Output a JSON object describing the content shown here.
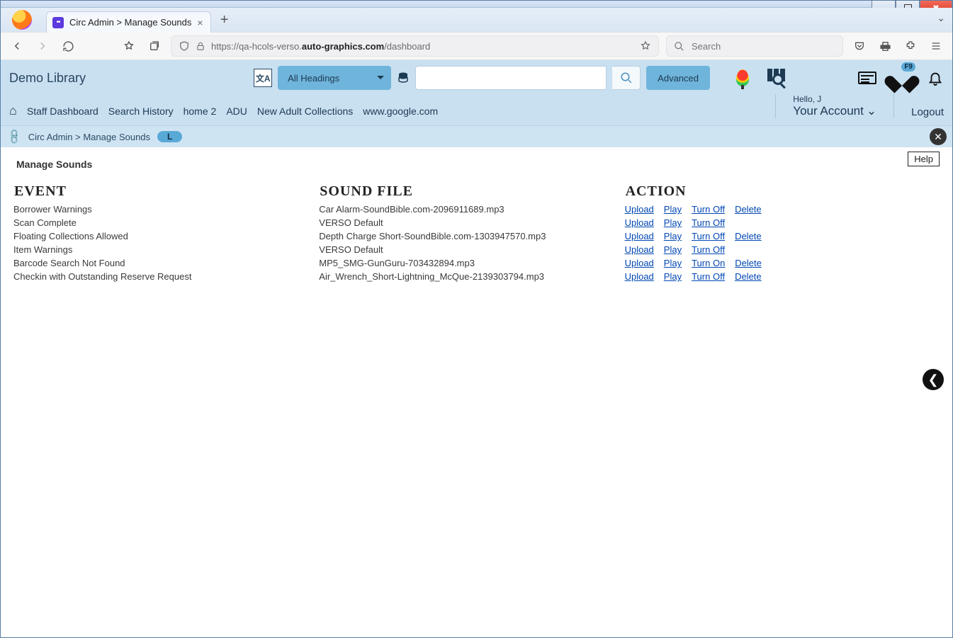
{
  "browser": {
    "tab_title": "Circ Admin > Manage Sounds",
    "url_prefix": "https://qa-hcols-verso.",
    "url_bold": "auto-graphics.com",
    "url_suffix": "/dashboard",
    "search_placeholder": "Search"
  },
  "app": {
    "brand": "Demo Library",
    "heading_select": "All Headings",
    "advanced": "Advanced",
    "nav": [
      "Staff Dashboard",
      "Search History",
      "home 2",
      "ADU",
      "New Adult Collections",
      "www.google.com"
    ],
    "hello": "Hello, J",
    "your_account": "Your Account",
    "logout": "Logout",
    "fav_badge": "F9"
  },
  "crumb": {
    "path": "Circ Admin > Manage Sounds",
    "pill": "L"
  },
  "page": {
    "title": "Manage Sounds",
    "help": "Help",
    "headers": {
      "event": "EVENT",
      "sound": "SOUND FILE",
      "action": "ACTION"
    },
    "action_labels": {
      "upload": "Upload",
      "play": "Play",
      "turn_on": "Turn On",
      "turn_off": "Turn Off",
      "delete": "Delete"
    },
    "rows": [
      {
        "event": "Borrower Warnings",
        "sound": "Car Alarm-SoundBible.com-2096911689.mp3",
        "toggle": "off",
        "delete": true
      },
      {
        "event": "Scan Complete",
        "sound": "VERSO Default",
        "toggle": "off",
        "delete": false
      },
      {
        "event": "Floating Collections Allowed",
        "sound": "Depth Charge Short-SoundBible.com-1303947570.mp3",
        "toggle": "off",
        "delete": true
      },
      {
        "event": "Item Warnings",
        "sound": "VERSO Default",
        "toggle": "off",
        "delete": false
      },
      {
        "event": "Barcode Search Not Found",
        "sound": "MP5_SMG-GunGuru-703432894.mp3",
        "toggle": "on",
        "delete": true
      },
      {
        "event": "Checkin with Outstanding Reserve Request",
        "sound": "Air_Wrench_Short-Lightning_McQue-2139303794.mp3",
        "toggle": "off",
        "delete": true
      }
    ]
  }
}
